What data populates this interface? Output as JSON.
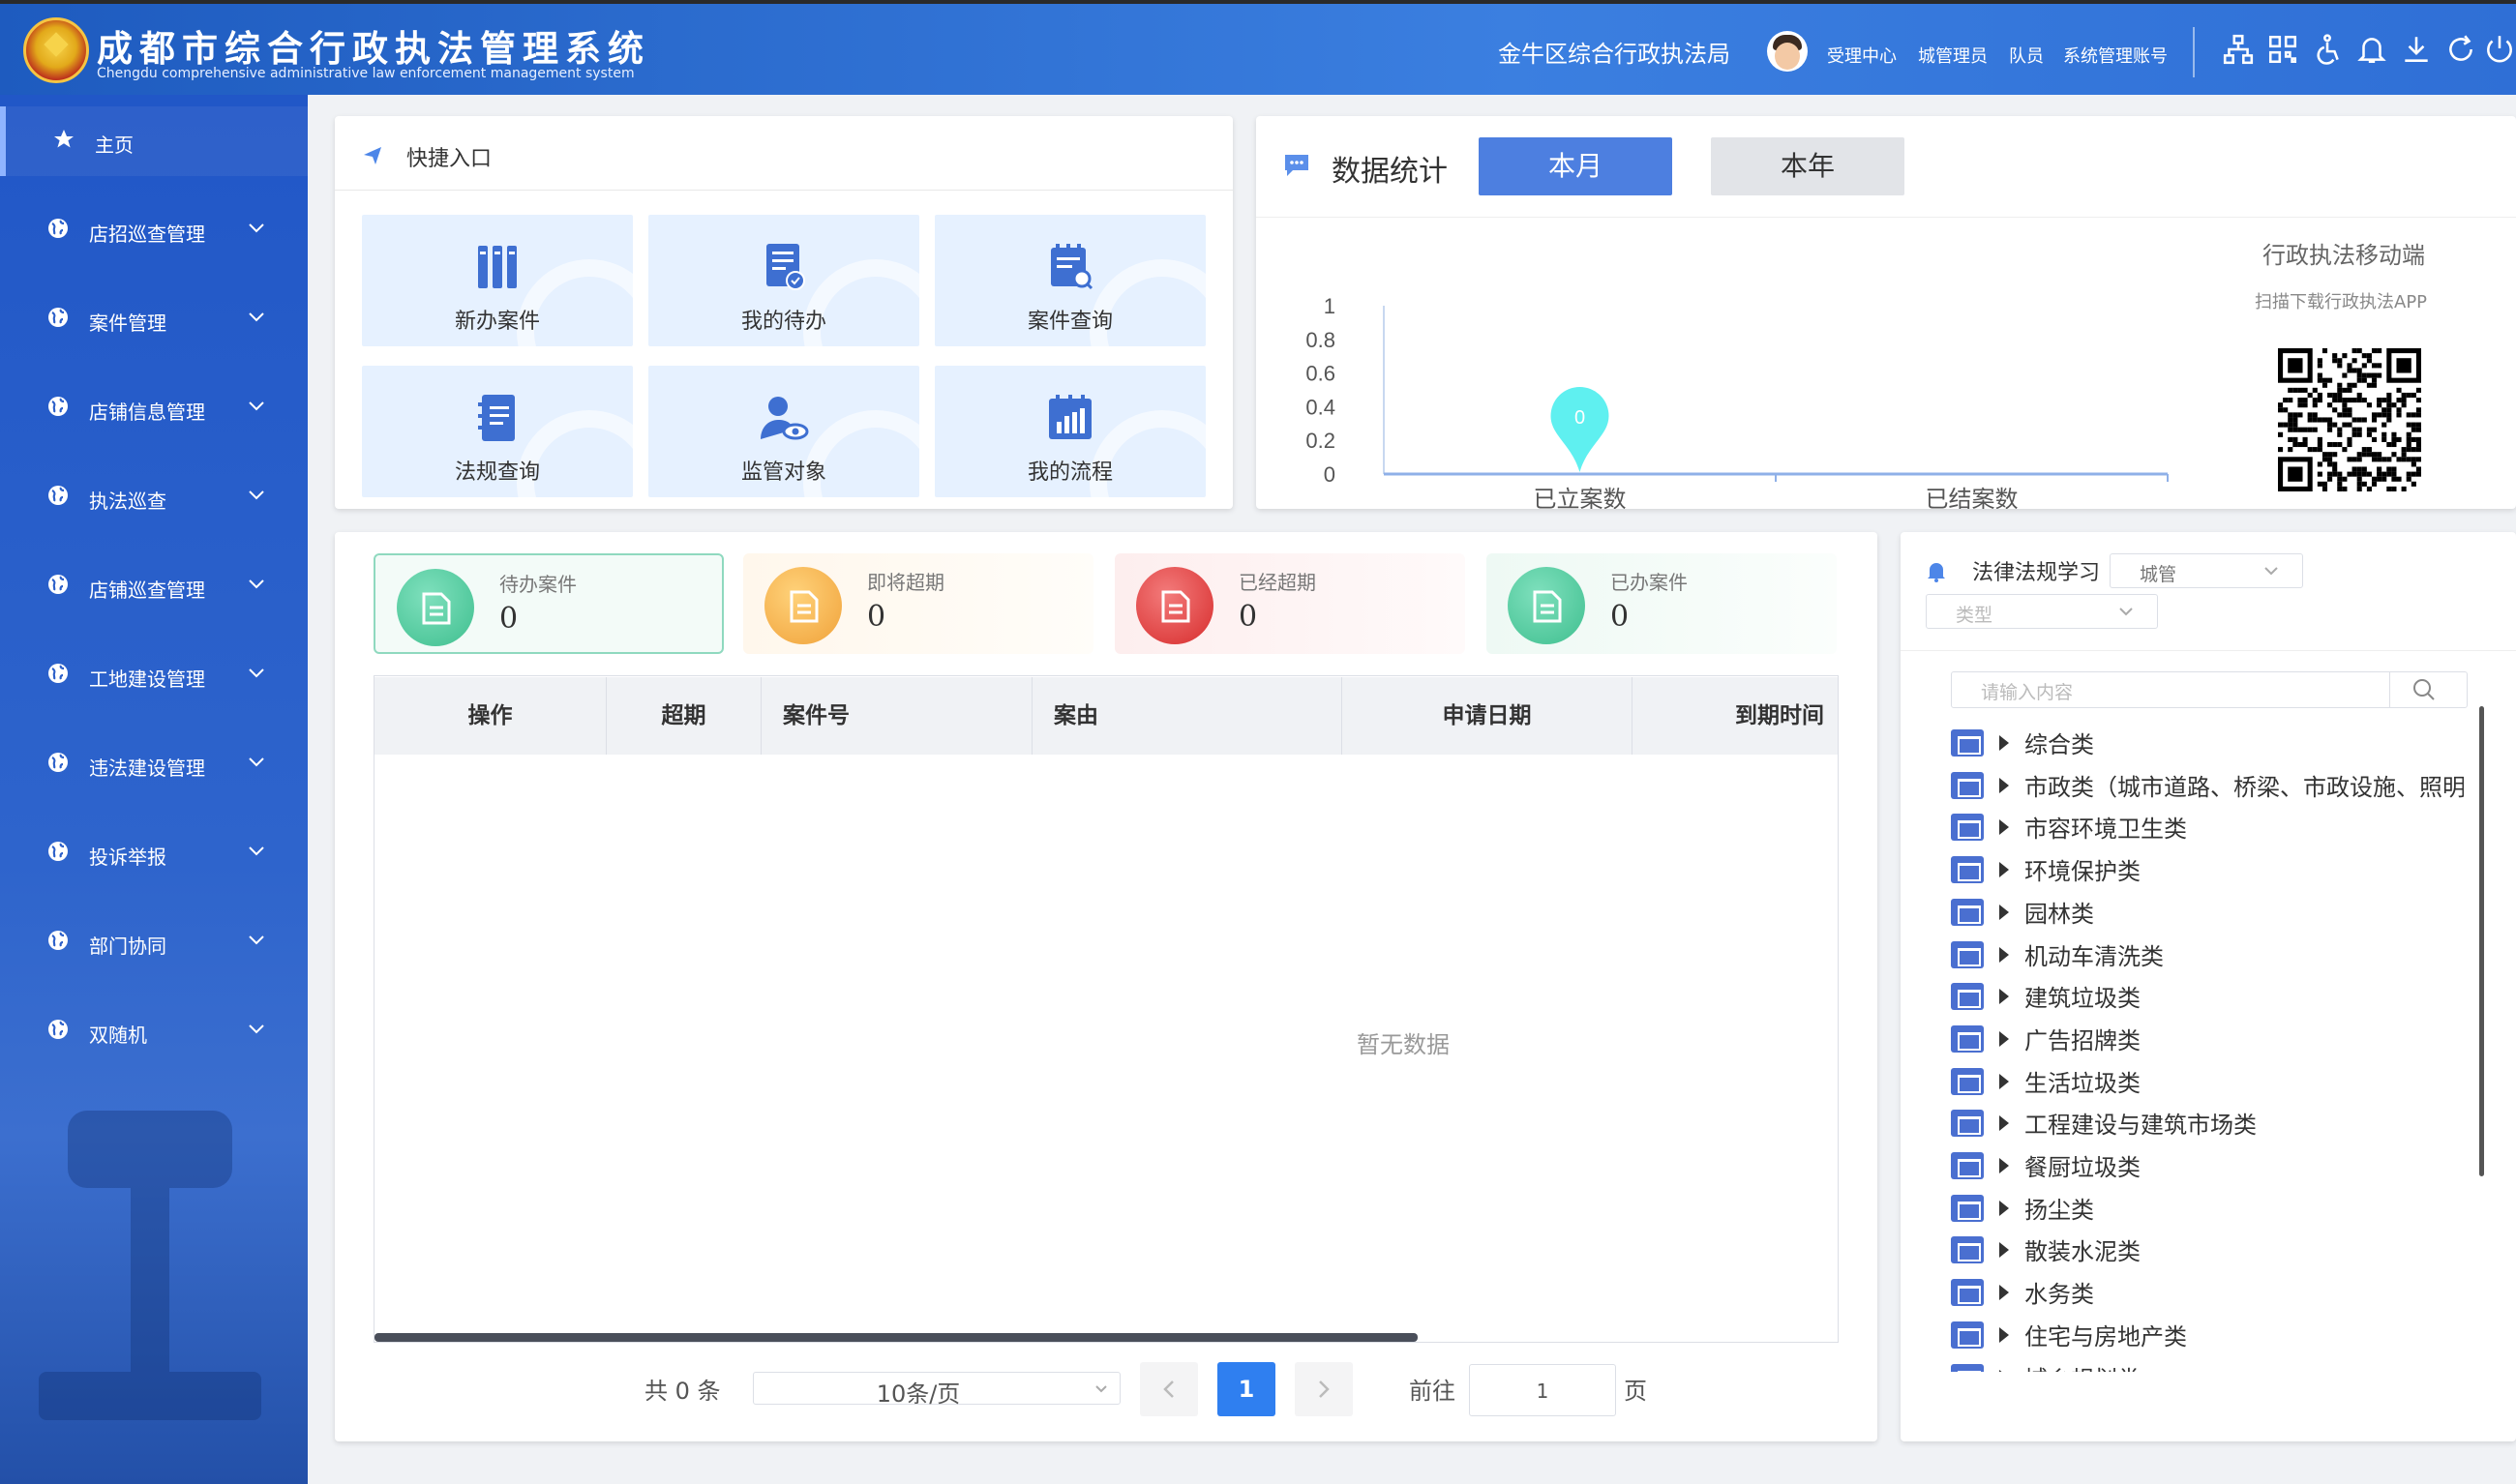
{
  "header": {
    "title": "成都市综合行政执法管理系统",
    "subtitle": "Chengdu comprehensive administrative law enforcement management system",
    "bureau": "金牛区综合行政执法局",
    "roles": [
      "受理中心",
      "城管理员",
      "队员",
      "系统管理账号"
    ],
    "icons": [
      "org-chart-icon",
      "qrcode-icon",
      "accessibility-icon",
      "bell-icon",
      "download-icon",
      "refresh-icon",
      "power-icon"
    ]
  },
  "sidebar": {
    "items": [
      {
        "label": "主页",
        "icon": "star-icon",
        "active": true
      },
      {
        "label": "店招巡查管理",
        "icon": "globe-icon"
      },
      {
        "label": "案件管理",
        "icon": "globe-icon"
      },
      {
        "label": "店铺信息管理",
        "icon": "globe-icon"
      },
      {
        "label": "执法巡查",
        "icon": "globe-icon"
      },
      {
        "label": "店铺巡查管理",
        "icon": "globe-icon"
      },
      {
        "label": "工地建设管理",
        "icon": "globe-icon"
      },
      {
        "label": "违法建设管理",
        "icon": "globe-icon"
      },
      {
        "label": "投诉举报",
        "icon": "globe-icon"
      },
      {
        "label": "部门协同",
        "icon": "globe-icon"
      },
      {
        "label": "双随机",
        "icon": "globe-icon"
      }
    ]
  },
  "quick": {
    "title": "快捷入口",
    "tiles": [
      {
        "label": "新办案件",
        "icon": "folders-icon"
      },
      {
        "label": "我的待办",
        "icon": "todo-doc-icon"
      },
      {
        "label": "案件查询",
        "icon": "calendar-search-icon"
      },
      {
        "label": "法规查询",
        "icon": "notebook-icon"
      },
      {
        "label": "监管对象",
        "icon": "user-eye-icon"
      },
      {
        "label": "我的流程",
        "icon": "bar-calendar-icon"
      }
    ]
  },
  "stats": {
    "title": "数据统计",
    "tabs": [
      "本月",
      "本年"
    ],
    "active_tab": "本月",
    "mobile_title": "行政执法移动端",
    "mobile_sub": "扫描下载行政执法APP",
    "colors": {
      "tab_active": "#4d7fe0",
      "tab_inactive": "#e2e4e8",
      "marker": "#5ff0f0"
    }
  },
  "chart_data": {
    "type": "bar",
    "categories": [
      "已立案数",
      "已结案数"
    ],
    "values": [
      0,
      0
    ],
    "ylim": [
      0,
      1
    ],
    "yticks": [
      "1",
      "0.8",
      "0.6",
      "0.4",
      "0.2",
      "0"
    ],
    "marker_label": "0",
    "title": "",
    "xlabel": "",
    "ylabel": ""
  },
  "summary": [
    {
      "label": "待办案件",
      "value": "0",
      "color": "#3fbf8f"
    },
    {
      "label": "即将超期",
      "value": "0",
      "color": "#f0a23a"
    },
    {
      "label": "已经超期",
      "value": "0",
      "color": "#e23b3b"
    },
    {
      "label": "已办案件",
      "value": "0",
      "color": "#3fbf8f"
    }
  ],
  "table": {
    "columns": [
      "操作",
      "超期",
      "案件号",
      "案由",
      "申请日期",
      "到期时间"
    ],
    "empty_text": "暂无数据"
  },
  "pagination": {
    "total": "共 0 条",
    "page_size": "10条/页",
    "current_page": "1",
    "goto_label": "前往",
    "goto_value": "1",
    "page_suffix": "页"
  },
  "law": {
    "title": "法律法规学习",
    "filter1": "城管",
    "filter2_placeholder": "类型",
    "search_placeholder": "请输入内容",
    "items": [
      "综合类",
      "市政类（城市道路、桥梁、市政设施、照明）",
      "市容环境卫生类",
      "环境保护类",
      "园林类",
      "机动车清洗类",
      "建筑垃圾类",
      "广告招牌类",
      "生活垃圾类",
      "工程建设与建筑市场类",
      "餐厨垃圾类",
      "扬尘类",
      "散装水泥类",
      "水务类",
      "住宅与房地产类",
      "城乡规划类"
    ]
  }
}
